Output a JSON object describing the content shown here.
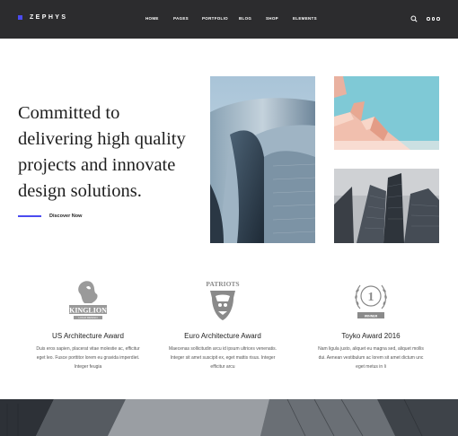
{
  "brand": {
    "name": "ZEPHYS",
    "accent": "#4b4bf0"
  },
  "nav": {
    "items": [
      {
        "label": "HOME"
      },
      {
        "label": "PAGES"
      },
      {
        "label": "PORTFOLIO"
      },
      {
        "label": "BLOG"
      },
      {
        "label": "SHOP"
      },
      {
        "label": "ELEMENTS"
      }
    ],
    "icons": [
      "search-icon",
      "more-icon"
    ]
  },
  "hero": {
    "headline_lines": [
      "Committed to",
      "delivering high quality",
      "projects and innovate",
      "design solutions."
    ],
    "cta_label": "Discover Now"
  },
  "awards": [
    {
      "logo_text": "KINGLION",
      "logo_subtext": "LOGO DESIGN",
      "title": "US Architecture Award",
      "description": "Duis eros sapien, placerat vitae molestie ac, efficitur eget leo. Fusce porttitor lorem eu gravida imperdiet. Integer feugia"
    },
    {
      "logo_text": "PATRIOTS",
      "title": "Euro Architecture Award",
      "description": "Maecenas sollicitudin arcu id ipsum ultrices venenatis. Integer sit amet suscipit ex, eget mattis risus. Integer efficitur arcu"
    },
    {
      "logo_text": "WINNER",
      "logo_numeral": "1",
      "title": "Toyko Award 2016",
      "description": "Nam ligula justo, aliquet eu magna sed, aliquet mollis dui. Aenean vestibulum ac lorem sit amet dictum unc eget metus in li"
    }
  ]
}
